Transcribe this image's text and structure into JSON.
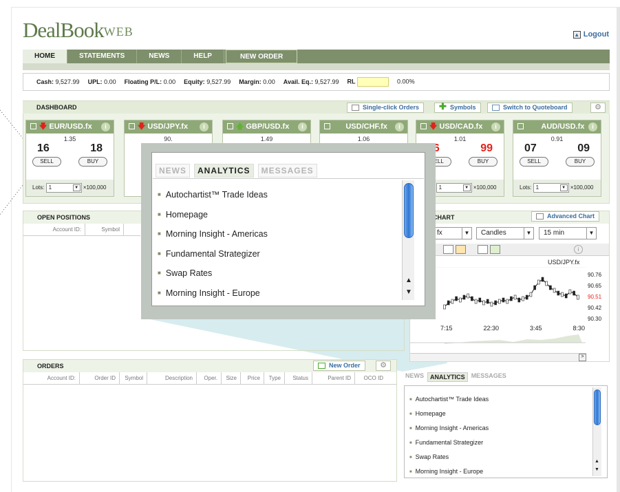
{
  "app": {
    "logo_main": "DealBook",
    "logo_sup": "WEB",
    "logout": "Logout"
  },
  "nav": {
    "tabs": [
      "HOME",
      "STATEMENTS",
      "NEWS",
      "HELP"
    ],
    "new_order": "NEW ORDER"
  },
  "account": {
    "cash_label": "Cash:",
    "cash": "9,527.99",
    "upl_label": "UPL:",
    "upl": "0.00",
    "fpl_label": "Floating P/L:",
    "fpl": "0.00",
    "equity_label": "Equity:",
    "equity": "9,527.99",
    "margin_label": "Margin:",
    "margin": "0.00",
    "avail_label": "Avail. Eq.:",
    "avail": "9,527.99",
    "rl_label": "RL",
    "rl": "0.00%"
  },
  "dashboard": {
    "title": "DASHBOARD",
    "single_click": "Single-click Orders",
    "symbols": "Symbols",
    "quoteboard": "Switch to Quoteboard",
    "tiles": [
      {
        "pair": "EUR/USD.fx",
        "dir": "down",
        "big": "1.35",
        "sell": "16",
        "buy": "18",
        "lots": "1"
      },
      {
        "pair": "USD/JPY.fx",
        "dir": "down",
        "big": "90.",
        "sell": "",
        "buy": "",
        "lots": ""
      },
      {
        "pair": "GBP/USD.fx",
        "dir": "up",
        "big": "1.49",
        "sell": "",
        "buy": "",
        "lots": ""
      },
      {
        "pair": "USD/CHF.fx",
        "dir": "none",
        "big": "1.06",
        "sell": "",
        "buy": "",
        "lots": ""
      },
      {
        "pair": "USD/CAD.fx",
        "dir": "down",
        "big": "1.01",
        "sell": "96",
        "buy": "99",
        "lots": "1"
      },
      {
        "pair": "AUD/USD.fx",
        "dir": "none",
        "big": "0.91",
        "sell": "07",
        "buy": "09",
        "lots": "1"
      }
    ],
    "sell_label": "SELL",
    "buy_label": "BUY",
    "lots_label": "Lots:",
    "mult": "×100,000"
  },
  "open_positions": {
    "title": "OPEN POSITIONS",
    "columns": [
      "Account ID:",
      "Symbol"
    ]
  },
  "orders": {
    "title": "ORDERS",
    "new_order": "New Order",
    "columns": [
      "Account ID:",
      "Order ID",
      "Symbol",
      "Description",
      "Oper.",
      "Size",
      "Price",
      "Type",
      "Status",
      "Parent ID",
      "OCO ID"
    ]
  },
  "chart": {
    "title": "K CHART",
    "advanced": "Advanced Chart",
    "symbol_sel": "fx",
    "type_sel": "Candles",
    "interval_sel": "15 min",
    "symbol": "USD/JPY.fx",
    "y_ticks": [
      "90.76",
      "90.65",
      "90.51",
      "90.42",
      "90.30"
    ],
    "x_ticks": [
      "7:15",
      "22:30",
      "3:45",
      "8:30"
    ]
  },
  "research": {
    "tabs": [
      "NEWS",
      "ANALYTICS",
      "MESSAGES"
    ],
    "active": "ANALYTICS",
    "items": [
      "Autochartist™ Trade Ideas",
      "Homepage",
      "Morning Insight - Americas",
      "Fundamental Strategizer",
      "Swap Rates",
      "Morning Insight - Europe"
    ]
  },
  "colors": {
    "brand": "#7e8f6c",
    "panel": "#e4ecd9",
    "link": "#3a6d9e",
    "sell_red": "#e0231b"
  }
}
